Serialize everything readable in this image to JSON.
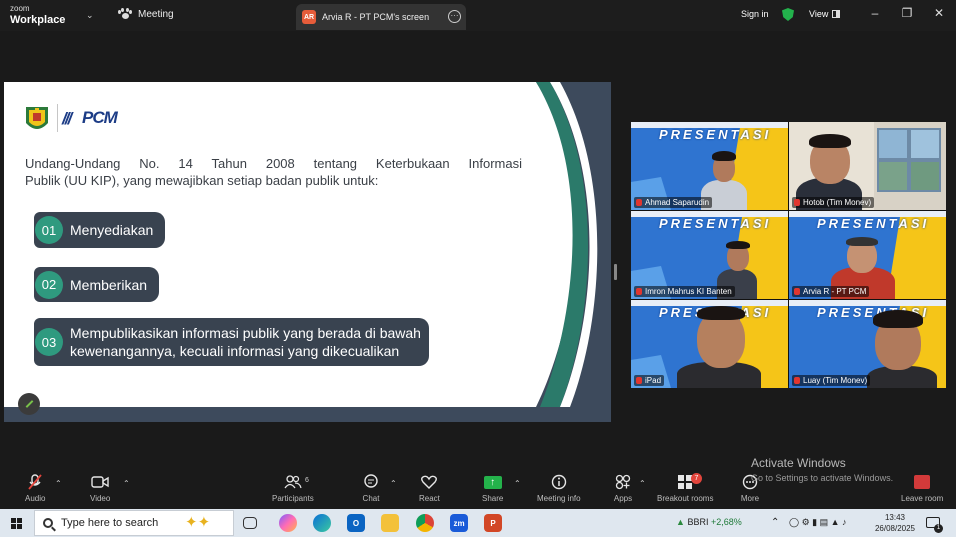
{
  "titlebar": {
    "brand_top": "zoom",
    "brand_bottom": "Workplace",
    "meeting_label": "Meeting",
    "screen_tab_badge": "AR",
    "screen_tab_label": "Arvia R - PT PCM's screen",
    "sign_in": "Sign in",
    "view": "View"
  },
  "slide": {
    "logo_text": "PCM",
    "intro_line1": "Undang-Undang No. 14 Tahun 2008 tentang Keterbukaan Informasi",
    "intro_line2": "Publik (UU KIP), yang mewajibkan setiap badan publik untuk:",
    "items": [
      {
        "num": "01",
        "label": "Menyediakan"
      },
      {
        "num": "02",
        "label": "Memberikan"
      },
      {
        "num": "03",
        "line1": "Mempublikasikan informasi publik yang berada di bawah",
        "line2": "kewenangannya, kecuali informasi yang dikecualikan"
      }
    ],
    "colors": {
      "teal": "#2f9a7f",
      "navy": "#394350",
      "band": "#3d4a5c",
      "band_green": "#2b7a6a"
    }
  },
  "gallery": {
    "presentation_word": "PRESENTASI",
    "participants": [
      {
        "name": "Ahmad Saparudin"
      },
      {
        "name": "Hotob (Tim Monev)"
      },
      {
        "name": "Imron Mahrus KI Banten"
      },
      {
        "name": "Arvia R - PT PCM"
      },
      {
        "name": "iPad"
      },
      {
        "name": "Luay (Tim Monev)"
      }
    ]
  },
  "toolbar": {
    "audio": "Audio",
    "video": "Video",
    "participants": "Participants",
    "participants_count": "6",
    "chat": "Chat",
    "react": "React",
    "share": "Share",
    "meeting_info": "Meeting info",
    "apps": "Apps",
    "breakout": "Breakout rooms",
    "breakout_badge": "7",
    "more": "More",
    "leave": "Leave room",
    "activate_title": "Activate Windows",
    "activate_sub": "Go to Settings to activate Windows."
  },
  "taskbar": {
    "search_placeholder": "Type here to search",
    "stock_name": "BBRI",
    "stock_change": "+2,68%",
    "time": "13:43",
    "date": "26/08/2025",
    "notif_count": "1"
  }
}
